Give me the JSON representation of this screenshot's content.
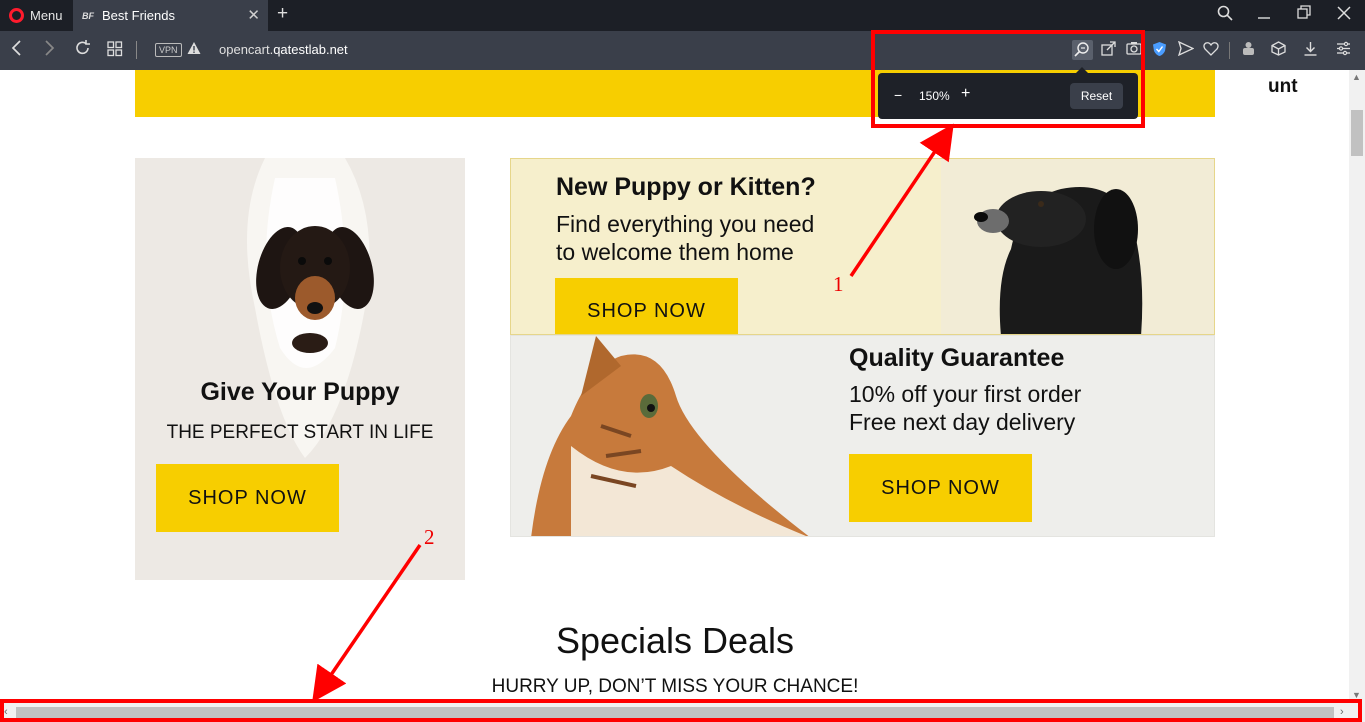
{
  "browser": {
    "menu_label": "Menu",
    "tab_favicon": "BF",
    "tab_title": "Best Friends",
    "tab_close": "✕",
    "new_tab": "+",
    "vpn_label": "VPN",
    "url_prefix": "opencart.",
    "url_domain": "qatestlab.net",
    "window_controls": [
      "search-icon",
      "minimize-icon",
      "restore-icon",
      "close-icon"
    ]
  },
  "zoom_popup": {
    "minus": "−",
    "value": "150%",
    "plus": "+",
    "reset_label": "Reset"
  },
  "page": {
    "account_text": "unt",
    "banner_left": {
      "title": "Give Your Puppy",
      "subtitle": "THE PERFECT START IN LIFE",
      "button": "SHOP NOW"
    },
    "banner_top": {
      "title": "New Puppy or Kitten?",
      "line1": "Find everything you need",
      "line2": "to welcome them home",
      "button": "SHOP NOW"
    },
    "banner_bottom": {
      "title": "Quality Guarantee",
      "line1": "10% off your first order",
      "line2": "Free next day delivery",
      "button": "SHOP NOW"
    },
    "specials": {
      "title": "Specials Deals",
      "subtitle": "HURRY UP, DON’T MISS YOUR CHANCE!"
    }
  },
  "annotations": {
    "label_1": "1",
    "label_2": "2",
    "color": "#ff0000"
  },
  "colors": {
    "accent_yellow": "#f7ce00",
    "browser_dark": "#1c1f26",
    "browser_bar": "#3a3f4a"
  }
}
